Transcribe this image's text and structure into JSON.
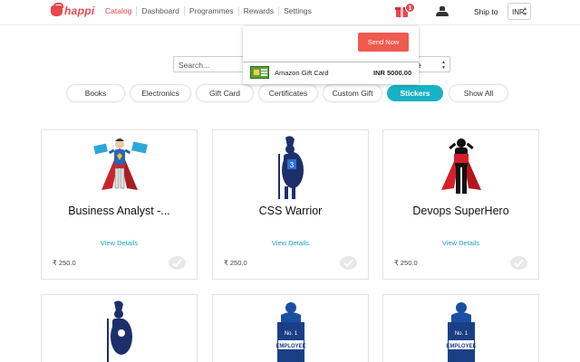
{
  "brand": {
    "name": "happi"
  },
  "nav": {
    "items": [
      "Catalog",
      "Dashboard",
      "Programmes",
      "Rewards",
      "Settings"
    ],
    "active": "Catalog"
  },
  "header": {
    "cart_count": "1",
    "ship_to_label": "Ship to",
    "currency": "INR"
  },
  "cart_popover": {
    "send_button": "Send Now",
    "items": [
      {
        "name": "Amazon Gift Card",
        "price": "INR 5000.00"
      }
    ]
  },
  "search": {
    "placeholder": "Search..."
  },
  "sort": {
    "visible_value": "me"
  },
  "categories": {
    "tabs": [
      "Books",
      "Electronics",
      "Gift Card",
      "Certificates",
      "Custom Gift",
      "Stickers",
      "Show All"
    ],
    "active": "Stickers"
  },
  "products": [
    {
      "title": "Business Analyst -...",
      "details_label": "View Details",
      "price": "₹ 250.0",
      "icon": "superhero-sticker-icon"
    },
    {
      "title": "CSS Warrior",
      "details_label": "View Details",
      "price": "₹ 250.0",
      "icon": "spartan-warrior-icon"
    },
    {
      "title": "Devops SuperHero",
      "details_label": "View Details",
      "price": "₹ 250.0",
      "icon": "caped-hero-silhouette-icon"
    },
    {
      "title": "",
      "details_label": "",
      "price": "",
      "icon": "spartan-warrior-icon"
    },
    {
      "title": "",
      "details_label": "",
      "price": "",
      "icon": "employee-badge-icon"
    },
    {
      "title": "",
      "details_label": "",
      "price": "",
      "icon": "employee-badge-icon"
    }
  ],
  "colors": {
    "accent": "#e8474c",
    "active_tab": "#19b2c5",
    "link": "#19a3b8",
    "send_button": "#f05a4f"
  }
}
